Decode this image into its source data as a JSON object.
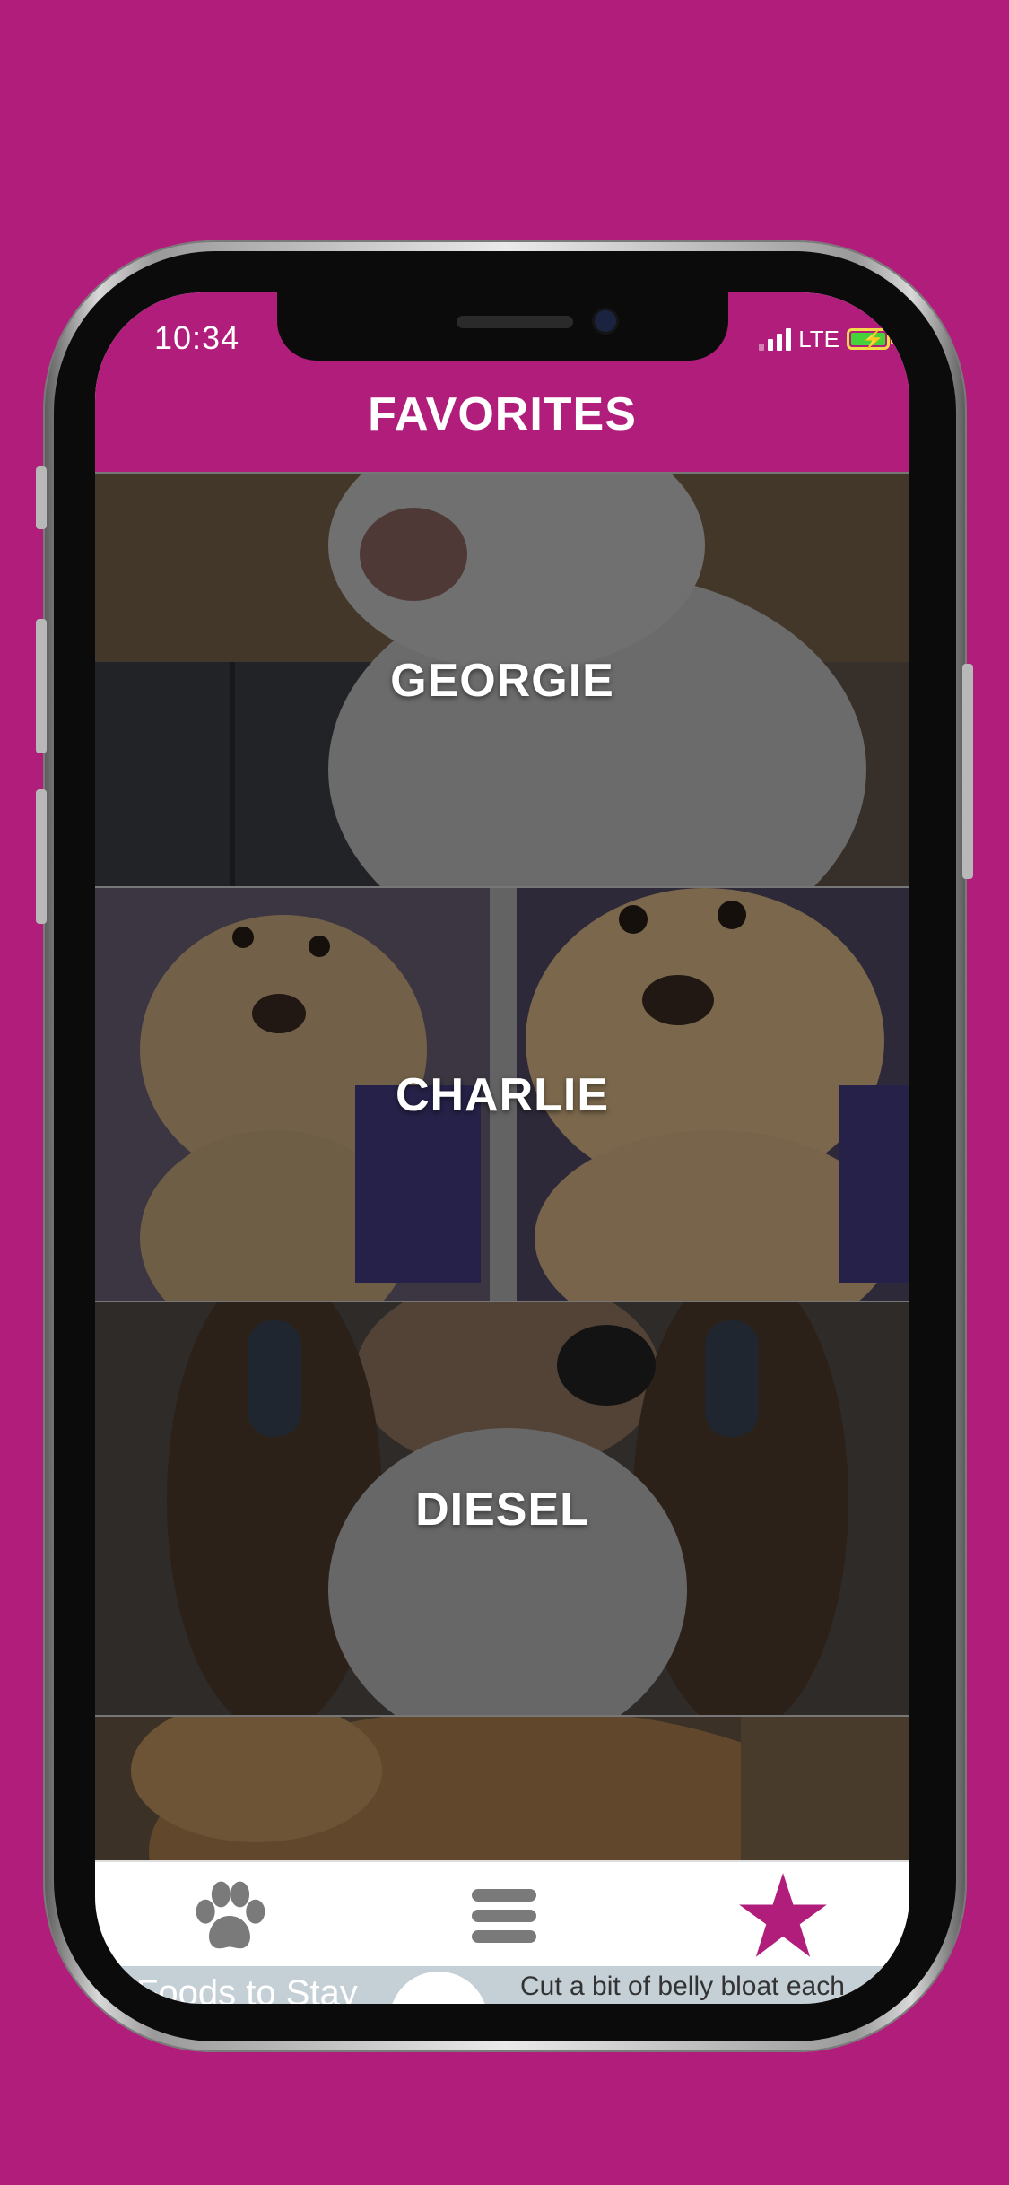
{
  "status_bar": {
    "time": "10:34",
    "network": "LTE"
  },
  "header": {
    "title": "FAVORITES"
  },
  "favorites": [
    {
      "name": "GEORGIE"
    },
    {
      "name": "CHARLIE"
    },
    {
      "name": "DIESEL"
    },
    {
      "name": ""
    }
  ],
  "tab_bar": {
    "items": [
      {
        "icon": "paw-icon",
        "selected": false
      },
      {
        "icon": "menu-icon",
        "selected": false
      },
      {
        "icon": "star-icon",
        "selected": true
      }
    ]
  },
  "ad_banner": {
    "left_text": "Foods to Stay",
    "right_text": "Cut a bit of belly bloat each"
  },
  "colors": {
    "brand": "#b11d7b",
    "tab_inactive": "#7a7a7a",
    "tab_active": "#b11d7b"
  }
}
